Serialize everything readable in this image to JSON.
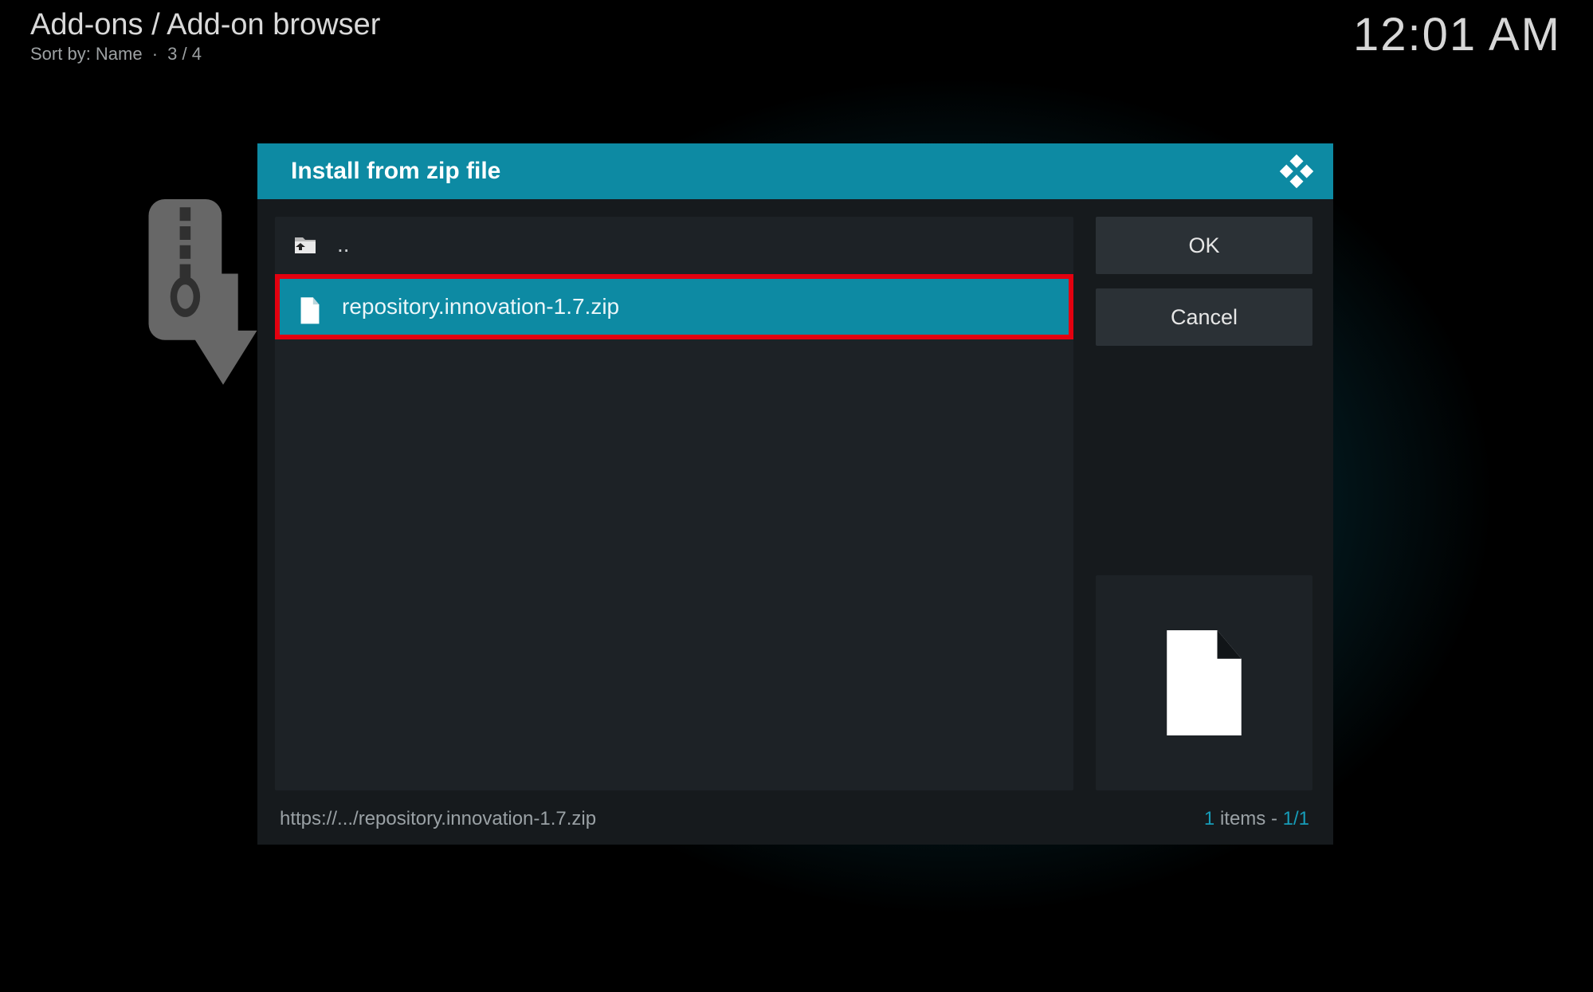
{
  "header": {
    "breadcrumb": "Add-ons / Add-on browser",
    "sort_prefix": "Sort by: ",
    "sort_value": "Name",
    "position": "3 / 4",
    "clock": "12:01 AM"
  },
  "dialog": {
    "title": "Install from zip file",
    "buttons": {
      "ok": "OK",
      "cancel": "Cancel"
    },
    "items": [
      {
        "icon": "folder-up",
        "label": "..",
        "selected": false
      },
      {
        "icon": "file",
        "label": "repository.innovation-1.7.zip",
        "selected": true,
        "highlighted": true
      }
    ],
    "footer": {
      "path": "https://.../repository.innovation-1.7.zip",
      "count_num": "1",
      "count_label": " items - ",
      "page": "1/1"
    }
  },
  "colors": {
    "accent": "#0d8aa3",
    "highlight": "#e3000f"
  }
}
